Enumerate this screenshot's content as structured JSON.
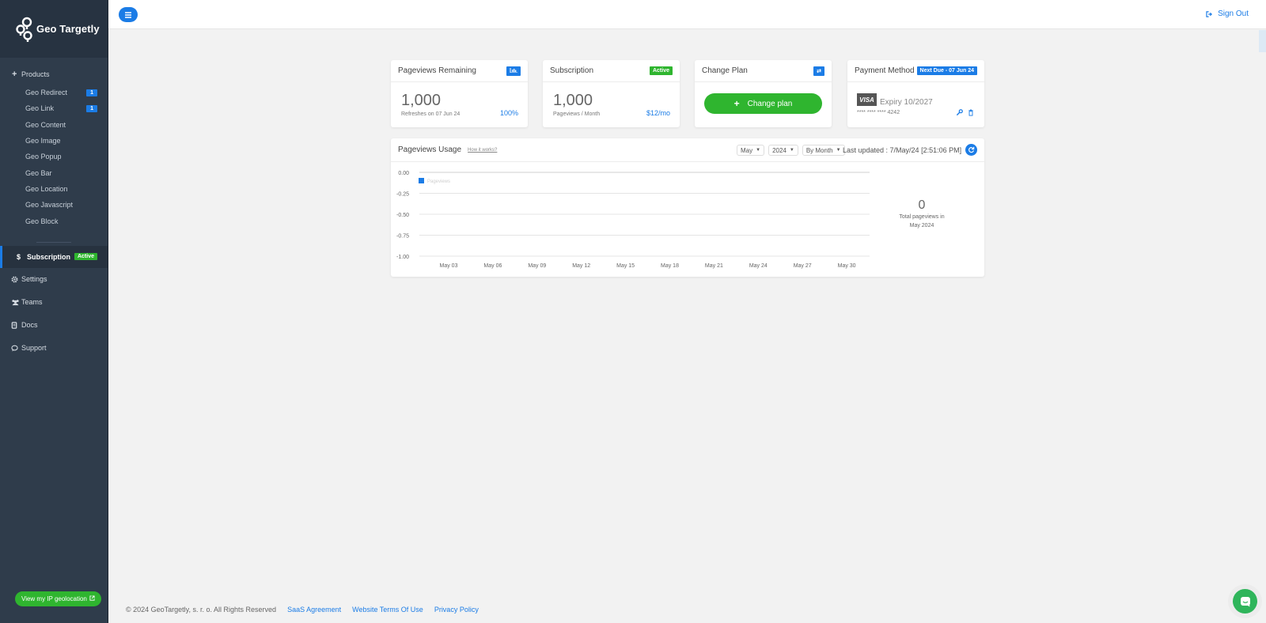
{
  "brand": {
    "name": "Geo Targetly"
  },
  "sidebar": {
    "products_label": "Products",
    "products": [
      {
        "label": "Geo Redirect",
        "badge": "1"
      },
      {
        "label": "Geo Link",
        "badge": "1"
      },
      {
        "label": "Geo Content",
        "badge": ""
      },
      {
        "label": "Geo Image",
        "badge": ""
      },
      {
        "label": "Geo Popup",
        "badge": ""
      },
      {
        "label": "Geo Bar",
        "badge": ""
      },
      {
        "label": "Geo Location",
        "badge": ""
      },
      {
        "label": "Geo Javascript",
        "badge": ""
      },
      {
        "label": "Geo Block",
        "badge": ""
      }
    ],
    "subscription": {
      "label": "Subscription",
      "badge": "Active"
    },
    "items": [
      {
        "label": "Settings"
      },
      {
        "label": "Teams"
      },
      {
        "label": "Docs"
      },
      {
        "label": "Support"
      }
    ],
    "ip_button": "View my IP geolocation"
  },
  "topbar": {
    "signout": "Sign Out"
  },
  "cards": {
    "pageviews": {
      "title": "Pageviews Remaining",
      "value": "1,000",
      "sub": "Refreshes on 07 Jun 24",
      "percent": "100%"
    },
    "subscription": {
      "title": "Subscription",
      "badge": "Active",
      "value": "1,000",
      "sub": "Pageviews / Month",
      "price": "$12/mo"
    },
    "change_plan": {
      "title": "Change Plan",
      "button": "Change plan"
    },
    "payment": {
      "title": "Payment Method",
      "badge": "Next Due - 07 Jun 24",
      "card_brand": "VISA",
      "expiry": "Expiry 10/2027",
      "card_number": "**** **** **** 4242"
    }
  },
  "usage": {
    "title": "Pageviews Usage",
    "how_link": "How it works?",
    "month": "May",
    "year": "2024",
    "period": "By Month",
    "updated": "Last updated : 7/May/24 [2:51:06 PM]",
    "total_value": "0",
    "total_label_1": "Total pageviews in",
    "total_label_2": "May 2024"
  },
  "chart_data": {
    "type": "line",
    "series": [
      {
        "name": "Pageviews",
        "values": []
      }
    ],
    "x_ticks": [
      "May 03",
      "May 06",
      "May 09",
      "May 12",
      "May 15",
      "May 18",
      "May 21",
      "May 24",
      "May 27",
      "May 30"
    ],
    "y_ticks": [
      "0.00",
      "-0.25",
      "-0.50",
      "-0.75",
      "-1.00"
    ],
    "ylim": [
      -1.0,
      0.0
    ],
    "grid": true,
    "legend": "top-left"
  },
  "footer": {
    "copyright": "© 2024 GeoTargetly, s. r. o. All Rights Reserved",
    "links": [
      "SaaS Agreement",
      "Website Terms Of Use",
      "Privacy Policy"
    ]
  },
  "colors": {
    "accent": "#1b7ce6",
    "success": "#2fb52f",
    "sidebar": "#2f3c4b"
  }
}
